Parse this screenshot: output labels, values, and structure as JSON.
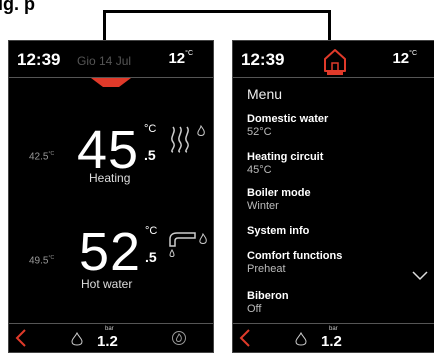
{
  "caption": "ig. p",
  "left_screen": {
    "time": "12:39",
    "date": "Gio 14 Jul",
    "ext_temp": "12",
    "ext_unit": "°C",
    "zones": [
      {
        "setpoint": "42.5",
        "setpoint_unit": "°C",
        "value": "45",
        "decimal": ".5",
        "unit": "°C",
        "name": "Heating"
      },
      {
        "setpoint": "49.5",
        "setpoint_unit": "°C",
        "value": "52",
        "decimal": ".5",
        "unit": "°C",
        "name": "Hot water"
      }
    ],
    "bar_label": "bar",
    "pressure": "1.2"
  },
  "right_screen": {
    "time": "12:39",
    "ext_temp": "12",
    "ext_unit": "°C",
    "menu_title": "Menu",
    "items": [
      {
        "label": "Domestic water",
        "value": "52°C"
      },
      {
        "label": "Heating circuit",
        "value": "45°C"
      },
      {
        "label": "Boiler mode",
        "value": "Winter"
      },
      {
        "label": "System info",
        "value": ""
      },
      {
        "label": "Comfort functions",
        "value": "Preheat"
      },
      {
        "label": "Biberon",
        "value": "Off"
      }
    ],
    "bar_label": "bar",
    "pressure": "1.2"
  },
  "colors": {
    "accent": "#e03a2a",
    "screen_bg": "#000000"
  },
  "icons": [
    "radiator-icon",
    "flame-icon",
    "faucet-icon",
    "drop-icon",
    "home-icon",
    "back-icon",
    "chevron-down-icon",
    "spiral-flame-icon"
  ]
}
